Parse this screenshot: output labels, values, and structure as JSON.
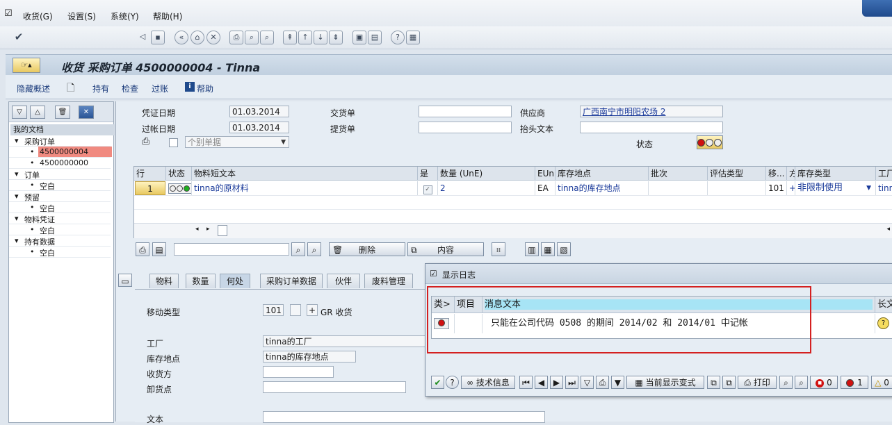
{
  "menu": {
    "items": [
      "收货(G)",
      "设置(S)",
      "系统(Y)",
      "帮助(H)"
    ]
  },
  "title": "收货 采购订单 4500000004 - Tinna",
  "app_toolbar": {
    "items": [
      "隐藏概述",
      "持有",
      "检查",
      "过账",
      "帮助"
    ]
  },
  "left_tree": {
    "header": "我的文档",
    "nodes": [
      {
        "label": "采购订单",
        "level": 0
      },
      {
        "label": "4500000004",
        "level": 1,
        "selected": true
      },
      {
        "label": "4500000000",
        "level": 1
      },
      {
        "label": "订单",
        "level": 0
      },
      {
        "label": "空白",
        "level": 1
      },
      {
        "label": "预留",
        "level": 0
      },
      {
        "label": "空白",
        "level": 1
      },
      {
        "label": "物料凭证",
        "level": 0
      },
      {
        "label": "空白",
        "level": 1
      },
      {
        "label": "持有数据",
        "level": 0
      },
      {
        "label": "空白",
        "level": 1
      }
    ]
  },
  "header_fields": {
    "doc_date_label": "凭证日期",
    "doc_date": "01.03.2014",
    "post_date_label": "过帐日期",
    "post_date": "01.03.2014",
    "delivery_note_label": "交货单",
    "bill_of_lading_label": "提货单",
    "vendor_label": "供应商",
    "vendor": "广西南宁市明阳农场 2",
    "header_text_label": "抬头文本",
    "slip_select": "个别单据",
    "status_label": "状态"
  },
  "items_grid": {
    "columns": [
      "行",
      "状态",
      "物料短文本",
      "是",
      "数量 (UnE)",
      "EUn",
      "库存地点",
      "批次",
      "评估类型",
      "移...",
      "方",
      "库存类型",
      "工厂"
    ],
    "rows": [
      {
        "line": "1",
        "text": "tinna的原材料",
        "qty": "2",
        "unit": "EA",
        "sloc": "tinna的库存地点",
        "mvt": "101",
        "sign": "+",
        "stock_type": "非限制使用",
        "plant": "tinn"
      }
    ]
  },
  "grid_toolbar": {
    "delete_label": "删除",
    "content_label": "内容"
  },
  "tabs": [
    "物料",
    "数量",
    "何处",
    "采购订单数据",
    "伙伴",
    "废料管理"
  ],
  "detail": {
    "mvt_label": "移动类型",
    "mvt_value": "101",
    "mvt_sign": "+",
    "mvt_text": "GR 收货",
    "plant_label": "工厂",
    "plant_value": "tinna的工厂",
    "sloc_label": "库存地点",
    "sloc_value": "tinna的库存地点",
    "recipient_label": "收货方",
    "unload_label": "卸货点",
    "text_label": "文本"
  },
  "log_dialog": {
    "title": "显示日志",
    "columns": [
      "类>",
      "项目",
      "消息文本",
      "长文"
    ],
    "rows": [
      {
        "message": "只能在公司代码 0508 的期间 2014/02 和 2014/01 中记帐"
      }
    ],
    "footer": {
      "tech_info": "技术信息",
      "current_layout": "当前显示变式",
      "print": "打印",
      "stop_count": "0",
      "error_count": "1",
      "warning_count": "0"
    }
  },
  "colors": {
    "selected_row": "#f08a80",
    "red_box": "#d42020",
    "link_text": "#1a3a9a"
  }
}
